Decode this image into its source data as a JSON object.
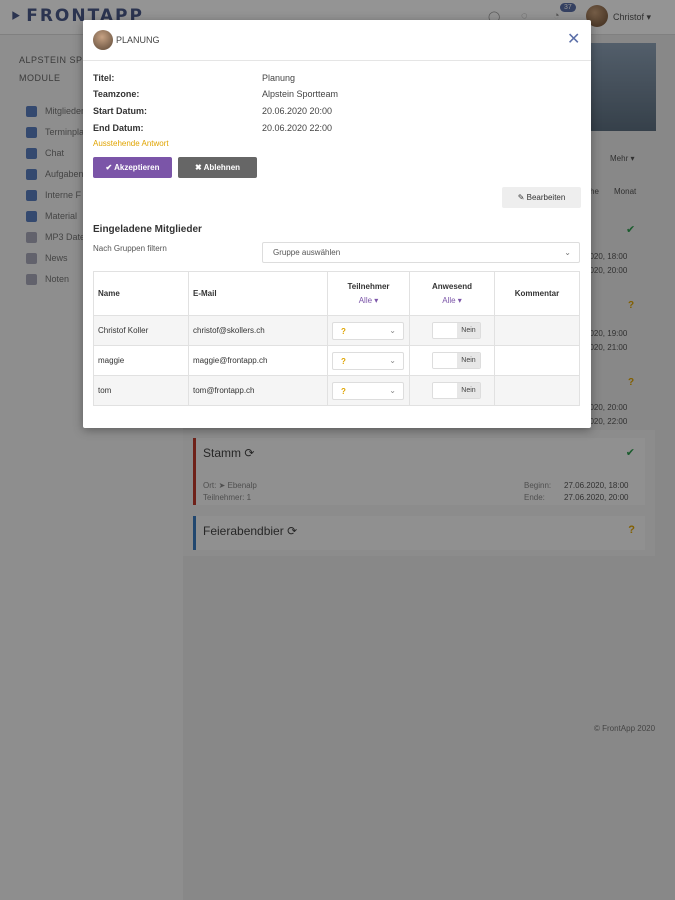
{
  "app": {
    "logo": "FRONTAPP",
    "badge_count": "37",
    "user_name": "Christof",
    "sidebar_heading": "ALPSTEIN SPO",
    "sidebar_subheading": "MODULE",
    "sidebar_items": [
      {
        "label": "Mitglieder",
        "icon": "users-icon"
      },
      {
        "label": "Terminpla",
        "icon": "calendar-icon"
      },
      {
        "label": "Chat",
        "icon": "chat-icon"
      },
      {
        "label": "Aufgaben",
        "icon": "list-icon"
      },
      {
        "label": "Interne F",
        "icon": "image-icon"
      },
      {
        "label": "Material",
        "icon": "list-icon"
      },
      {
        "label": "MP3 Date",
        "icon": "file-icon"
      },
      {
        "label": "News",
        "icon": "file-icon"
      },
      {
        "label": "Noten",
        "icon": "file-icon"
      }
    ],
    "view_more": "Mehr",
    "view_week": "he",
    "view_month": "Monat",
    "events": [
      {
        "title": "Stamm",
        "ort_label": "Ort:",
        "ort": "Ebenalp",
        "teilnehmer_label": "Teilnehmer:",
        "teilnehmer": "1",
        "begin_label": "Beginn:",
        "begin": "27.06.2020, 18:00",
        "end_label": "Ende:",
        "end": "27.06.2020, 20:00",
        "color": "#c0392b"
      },
      {
        "title": "Feierabendbier",
        "color": "#3a7bbf"
      }
    ],
    "background_times": [
      "2020, 18:00",
      "2020, 20:00",
      "2020, 19:00",
      "2020, 21:00",
      "2020, 20:00",
      "2020, 22:00"
    ],
    "footer": "© FrontApp 2020"
  },
  "modal": {
    "title": "PLANUNG",
    "fields": [
      {
        "label": "Titel:",
        "value": "Planung"
      },
      {
        "label": "Teamzone:",
        "value": "Alpstein Sportteam"
      },
      {
        "label": "Start Datum:",
        "value": "20.06.2020 20:00"
      },
      {
        "label": "End Datum:",
        "value": "20.06.2020 22:00"
      }
    ],
    "pending_text": "Ausstehende Antwort",
    "accept_label": "✔ Akzeptieren",
    "decline_label": "✖ Ablehnen",
    "edit_label": "✎ Bearbeiten",
    "section_title": "Eingeladene Mitglieder",
    "filter_label": "Nach Gruppen filtern",
    "filter_placeholder": "Gruppe auswählen",
    "table": {
      "headers": {
        "name": "Name",
        "email": "E-Mail",
        "teilnehmer": "Teilnehmer",
        "anwesend": "Anwesend",
        "kommentar": "Kommentar"
      },
      "sub_filter": "Alle ▾",
      "rows": [
        {
          "name": "Christof Koller",
          "email": "christof@skollers.ch",
          "status": "?",
          "anwesend": "Nein",
          "kommentar": ""
        },
        {
          "name": "maggie",
          "email": "maggie@frontapp.ch",
          "status": "?",
          "anwesend": "Nein",
          "kommentar": ""
        },
        {
          "name": "tom",
          "email": "tom@frontapp.ch",
          "status": "?",
          "anwesend": "Nein",
          "kommentar": ""
        }
      ]
    }
  },
  "colors": {
    "accent": "#7b55a8",
    "pending": "#e0a400",
    "decline": "#666666",
    "link": "#5b6fa8"
  }
}
